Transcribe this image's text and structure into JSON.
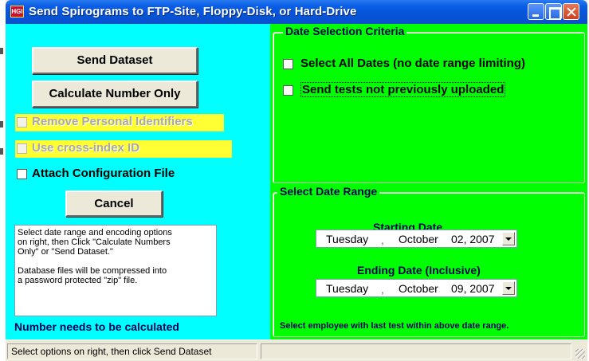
{
  "window": {
    "title": "Send Spirograms to FTP-Site, Floppy-Disk, or Hard-Drive",
    "app_icon_text": "HGI"
  },
  "left_panel": {
    "bg_color": "#00ffff",
    "send_button": "Send Dataset",
    "calc_button": "Calculate Number Only",
    "remove_identifiers": {
      "label": "Remove Personal Identifiers",
      "checked": false,
      "enabled": false
    },
    "cross_index": {
      "label": "Use cross-index ID",
      "checked": false,
      "enabled": false
    },
    "attach_config": {
      "label": "Attach Configuration File",
      "checked": false,
      "enabled": true
    },
    "cancel_button": "Cancel",
    "info_text": {
      "para1": "Select date range and encoding options\non right, then Click \"Calculate Numbers\nOnly\" or \"Send Dataset.\"",
      "para2": "Database files will be compressed into\na password protected \"zip\" file."
    },
    "status_label": "Number needs to be calculated"
  },
  "right_panel": {
    "bg_color": "#00ff00",
    "criteria_group": {
      "title": "Date Selection Criteria",
      "select_all": {
        "label": "Select All Dates (no date range limiting)",
        "checked": false
      },
      "not_uploaded": {
        "label": "Send tests not previously uploaded",
        "checked": false
      }
    },
    "range_group": {
      "title": "Select Date Range",
      "start_label": "Starting Date",
      "start_date": {
        "day": "Tuesday",
        "sep": ",",
        "month": "October",
        "date": "02, 2007"
      },
      "end_label": "Ending Date (Inclusive)",
      "end_date": {
        "day": "Tuesday",
        "sep": ",",
        "month": "October",
        "date": "09, 2007"
      }
    },
    "footer_note": "Select employee with last test within above date range."
  },
  "statusbar": {
    "pane1": "Select options on right, then click Send Dataset",
    "pane2": ""
  }
}
